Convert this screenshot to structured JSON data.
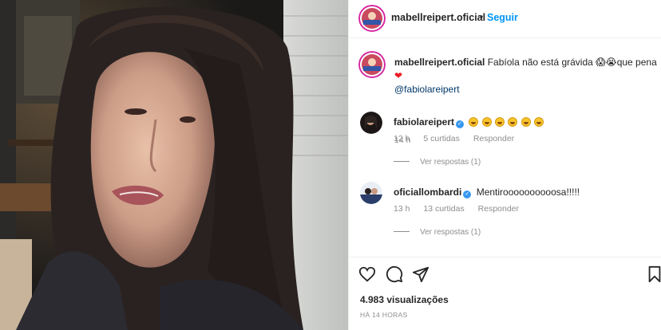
{
  "post": {
    "username": "mabellreipert.oficial",
    "follow_label": "Seguir",
    "dot": "•",
    "caption_text": "Fabíola não está grávida",
    "caption_emoji_1": "😱😭",
    "caption_text_2": "que pena",
    "caption_heart": "❤",
    "caption_mention": "@fabiolareipert",
    "caption_time": "14 h"
  },
  "comments": [
    {
      "username": "fabiolareipert",
      "verified": true,
      "text": "",
      "emoji_count": 6,
      "time": "12 h",
      "likes": "5 curtidas",
      "reply_label": "Responder",
      "view_replies": "Ver respostas (1)"
    },
    {
      "username": "oficiallombardi",
      "verified": true,
      "text": "Mentiroooooooooosa!!!!!",
      "time": "13 h",
      "likes": "13 curtidas",
      "reply_label": "Responder",
      "view_replies": "Ver respostas (1)"
    }
  ],
  "footer": {
    "views": "4.983 visualizações",
    "posted": "HÁ 14 HORAS"
  },
  "icons": {
    "like": "heart-outline-icon",
    "comment": "comment-bubble-icon",
    "share": "paper-plane-icon",
    "save": "bookmark-icon"
  },
  "colors": {
    "link_blue": "#0095f6",
    "mention": "#00376b",
    "muted": "#8e8e8e",
    "text": "#262626",
    "verified": "#3897f0",
    "heart_red": "#ed1c24"
  }
}
